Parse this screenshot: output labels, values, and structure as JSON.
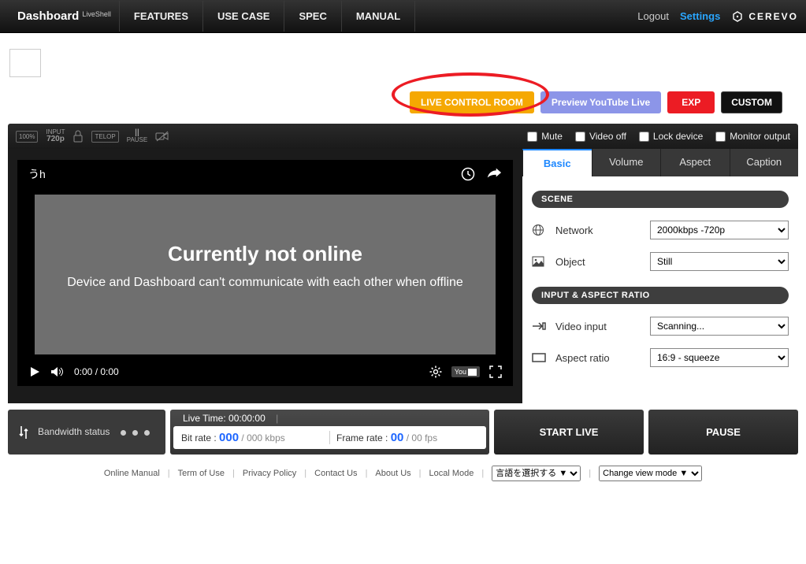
{
  "brand": {
    "title": "Dashboard",
    "sub": "LiveShell"
  },
  "nav": [
    "FEATURES",
    "USE CASE",
    "SPEC",
    "MANUAL"
  ],
  "topright": {
    "logout": "Logout",
    "settings": "Settings",
    "company": "CEREVO"
  },
  "mode_buttons": {
    "live_control": "LIVE CONTROL ROOM",
    "preview_yt": "Preview YouTube Live",
    "exp": "EXP",
    "custom": "CUSTOM"
  },
  "toolbar": {
    "input_label": "INPUT",
    "input_res": "720p",
    "batt": "100%",
    "telop": "TELOP",
    "pause_small": "PAUSE",
    "checks": {
      "mute": "Mute",
      "video_off": "Video off",
      "lock": "Lock device",
      "monitor": "Monitor output"
    }
  },
  "video": {
    "title": "うh",
    "offline_heading": "Currently not online",
    "offline_msg": "Device and Dashboard can't communicate with each other when offline",
    "time": "0:00 / 0:00",
    "yt": "YouTube"
  },
  "tabs": [
    "Basic",
    "Volume",
    "Aspect",
    "Caption"
  ],
  "panel": {
    "scene_header": "SCENE",
    "input_header": "INPUT & ASPECT RATIO",
    "network_label": "Network",
    "network_value": "2000kbps -720p",
    "object_label": "Object",
    "object_value": "Still",
    "videoinput_label": "Video input",
    "videoinput_value": "Scanning...",
    "aspect_label": "Aspect ratio",
    "aspect_value": "16:9 - squeeze"
  },
  "status": {
    "bw_label": "Bandwidth status",
    "live_time_label": "Live Time:",
    "live_time": "00:00:00",
    "bitrate_label": "Bit rate :",
    "bitrate_val": "000",
    "bitrate_max": "/ 000 kbps",
    "framerate_label": "Frame rate  :",
    "framerate_val": "00",
    "framerate_unit": "/ 00 fps",
    "start": "START LIVE",
    "pause": "PAUSE"
  },
  "footer": {
    "links": [
      "Online Manual",
      "Term of Use",
      "Privacy Policy",
      "Contact Us",
      "About Us",
      "Local Mode"
    ],
    "lang": "言語を選択する ▼",
    "viewmode": "Change view mode ▼"
  }
}
